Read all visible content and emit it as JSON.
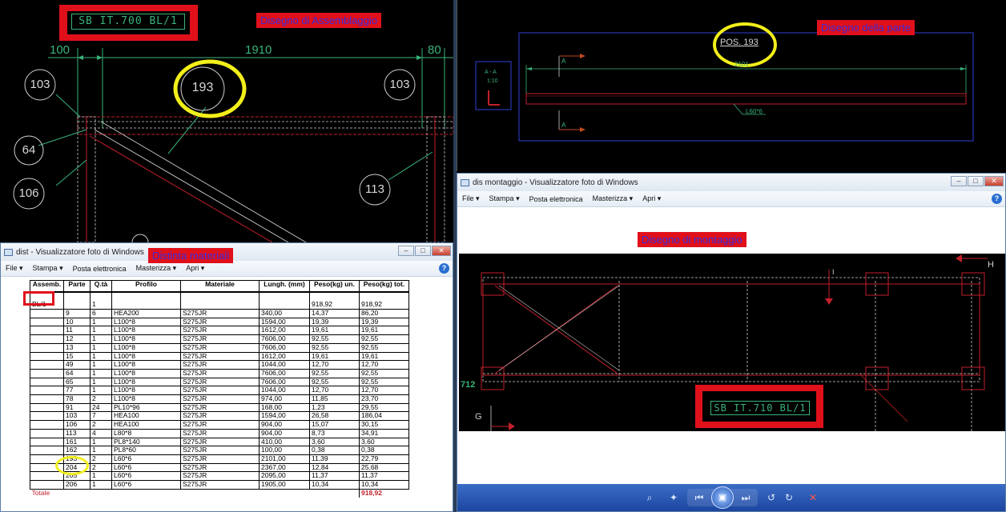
{
  "assembly_view": {
    "label": "Disegno di Assemblaggio",
    "tag": "SB IT.700 BL/1",
    "dim_left": "100",
    "dim_mid": "1910",
    "dim_right": "80",
    "bubbles": [
      "103",
      "193",
      "103",
      "64",
      "106",
      "113"
    ]
  },
  "part_view": {
    "label": "Disegno della parte",
    "pos": "POS. 193",
    "section_title": "A - A",
    "section_scale": "1:10",
    "section_marker": "A",
    "profile": "L60*6",
    "dim": "2101"
  },
  "dist_window": {
    "title": "dist - Visualizzatore foto di Windows",
    "label": "Distinta materiali",
    "menu": [
      "File",
      "Stampa",
      "Posta elettronica",
      "Masterizza",
      "Apri"
    ],
    "help": "?",
    "assembly_code": "BL/1",
    "columns": [
      "Assemb.",
      "Parte",
      "Q.tà",
      "Profilo",
      "Materiale",
      "Lungh. (mm)",
      "Peso(kg) un.",
      "Peso(kg) tot."
    ],
    "header_row": {
      "qty": "1",
      "unit": "918,92",
      "tot": "918,92"
    },
    "rows": [
      [
        "9",
        "6",
        "HEA200",
        "S275JR",
        "340,00",
        "14,37",
        "86,20"
      ],
      [
        "10",
        "1",
        "L100*8",
        "S275JR",
        "1594,00",
        "19,39",
        "19,39"
      ],
      [
        "11",
        "1",
        "L100*8",
        "S275JR",
        "1612,00",
        "19,61",
        "19,61"
      ],
      [
        "12",
        "1",
        "L100*8",
        "S275JR",
        "7606,00",
        "92,55",
        "92,55"
      ],
      [
        "13",
        "1",
        "L100*8",
        "S275JR",
        "7606,00",
        "92,55",
        "92,55"
      ],
      [
        "15",
        "1",
        "L100*8",
        "S275JR",
        "1612,00",
        "19,61",
        "19,61"
      ],
      [
        "49",
        "1",
        "L100*8",
        "S275JR",
        "1044,00",
        "12,70",
        "12,70"
      ],
      [
        "64",
        "1",
        "L100*8",
        "S275JR",
        "7606,00",
        "92,55",
        "92,55"
      ],
      [
        "65",
        "1",
        "L100*8",
        "S275JR",
        "7606,00",
        "92,55",
        "92,55"
      ],
      [
        "77",
        "1",
        "L100*8",
        "S275JR",
        "1044,00",
        "12,70",
        "12,70"
      ],
      [
        "78",
        "2",
        "L100*8",
        "S275JR",
        "974,00",
        "11,85",
        "23,70"
      ],
      [
        "91",
        "24",
        "PL10*96",
        "S275JR",
        "168,00",
        "1,23",
        "29,55"
      ],
      [
        "103",
        "7",
        "HEA100",
        "S275JR",
        "1594,00",
        "26,58",
        "186,04"
      ],
      [
        "106",
        "2",
        "HEA100",
        "S275JR",
        "904,00",
        "15,07",
        "30,15"
      ],
      [
        "113",
        "4",
        "L80*8",
        "S275JR",
        "904,00",
        "8,73",
        "34,91"
      ],
      [
        "161",
        "1",
        "PL8*140",
        "S275JR",
        "410,00",
        "3,60",
        "3,60"
      ],
      [
        "162",
        "1",
        "PL8*60",
        "S275JR",
        "100,00",
        "0,38",
        "0,38"
      ],
      [
        "193",
        "2",
        "L60*6",
        "S275JR",
        "2101,00",
        "11,39",
        "22,79"
      ],
      [
        "204",
        "2",
        "L60*6",
        "S275JR",
        "2367,00",
        "12,84",
        "25,68"
      ],
      [
        "205",
        "1",
        "L60*6",
        "S275JR",
        "2095,00",
        "11,37",
        "11,37"
      ],
      [
        "206",
        "1",
        "L60*6",
        "S275JR",
        "1905,00",
        "10,34",
        "10,34"
      ]
    ],
    "total_label": "Totale",
    "total_value": "918,92"
  },
  "mont_window": {
    "title": "dis montaggio - Visualizzatore foto di Windows",
    "label": "Disegno di montaggio",
    "menu": [
      "File",
      "Stampa",
      "Posta elettronica",
      "Masterizza",
      "Apri"
    ],
    "help": "?",
    "tag": "SB IT.710 BL/1",
    "left_num": "712",
    "marker_g": "G",
    "marker_h": "H",
    "marker_i": "I"
  },
  "colors": {
    "cad_bg": "#000000",
    "label_bg": "#e0101a",
    "label_text": "#3a2ad8",
    "highlight": "#f2ef1a",
    "cad_green": "#3ab37a",
    "cad_red": "#c0202a"
  }
}
